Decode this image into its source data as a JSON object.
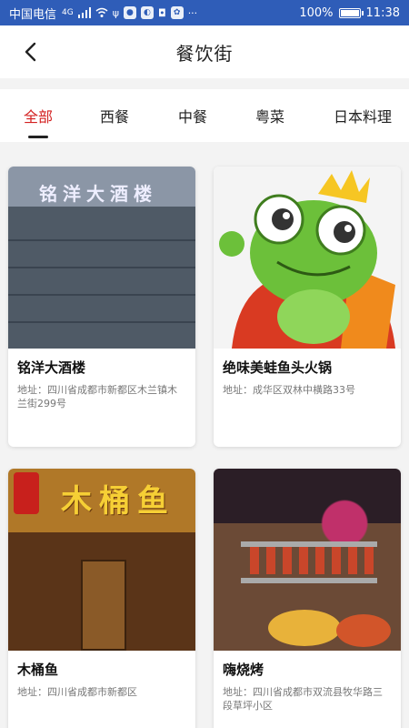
{
  "status_bar": {
    "carrier": "中国电信",
    "signal": "4G",
    "battery_percent": "100%",
    "time": "11:38",
    "battery_level": 1.0
  },
  "header": {
    "title": "餐饮街"
  },
  "tabs": [
    {
      "label": "全部",
      "active": true
    },
    {
      "label": "西餐",
      "active": false
    },
    {
      "label": "中餐",
      "active": false
    },
    {
      "label": "粤菜",
      "active": false
    },
    {
      "label": "日本料理",
      "active": false
    }
  ],
  "restaurants": [
    {
      "name": "铭洋大酒楼",
      "address": "地址：四川省成都市新都区木兰镇木兰街299号",
      "image_sign": "铭洋大酒楼"
    },
    {
      "name": "绝味美蛙鱼头火锅",
      "address": "地址：成华区双林中横路33号",
      "image_sign": ""
    },
    {
      "name": "木桶鱼",
      "address": "地址：四川省成都市新都区",
      "image_sign": "木桶鱼"
    },
    {
      "name": "嗨烧烤",
      "address": "地址：四川省成都市双流县牧华路三段草坪小区",
      "image_sign": ""
    }
  ]
}
